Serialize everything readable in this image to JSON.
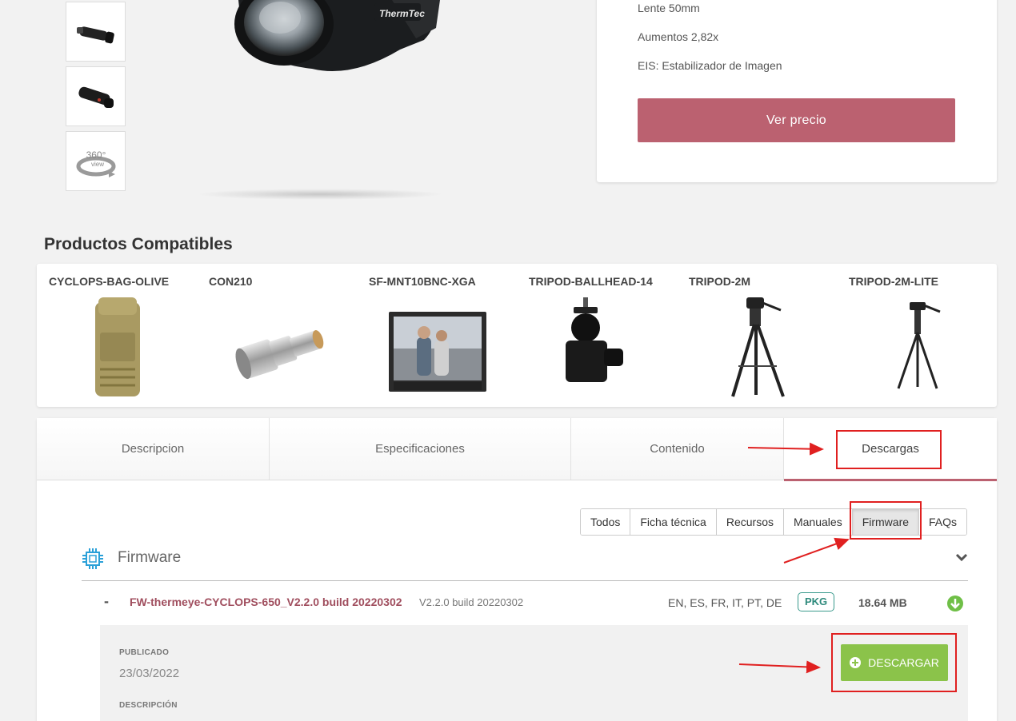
{
  "product": {
    "specs": [
      "Lente 50mm",
      "Aumentos 2,82x",
      "EIS: Estabilizador de Imagen"
    ],
    "price_button": "Ver precio",
    "brand_logo": "ThermTec",
    "view360": {
      "number": "360°",
      "word": "view"
    }
  },
  "compatibles": {
    "title": "Productos Compatibles",
    "items": [
      {
        "name": "CYCLOPS-BAG-OLIVE"
      },
      {
        "name": "CON210"
      },
      {
        "name": "SF-MNT10BNC-XGA"
      },
      {
        "name": "TRIPOD-BALLHEAD-14"
      },
      {
        "name": "TRIPOD-2M"
      },
      {
        "name": "TRIPOD-2M-LITE"
      }
    ]
  },
  "tabs": [
    "Descripcion",
    "Especificaciones",
    "Contenido",
    "Descargas"
  ],
  "filters": [
    "Todos",
    "Ficha técnica",
    "Recursos",
    "Manuales",
    "Firmware",
    "FAQs"
  ],
  "section": {
    "title": "Firmware"
  },
  "file": {
    "toggle": "-",
    "name": "FW-thermeye-CYCLOPS-650_V2.2.0 build 20220302",
    "version": "V2.2.0 build 20220302",
    "languages": "EN, ES, FR, IT, PT, DE",
    "badge": "PKG",
    "size": "18.64 MB"
  },
  "detail": {
    "published_label": "PUBLICADO",
    "published_value": "23/03/2022",
    "description_label": "DESCRIPCIÓN",
    "download_button": "DESCARGAR"
  },
  "colors": {
    "accent": "#bb6170",
    "download_green": "#8bc34a",
    "badge_teal": "#3a9a8c",
    "annotation_red": "#e02020"
  }
}
